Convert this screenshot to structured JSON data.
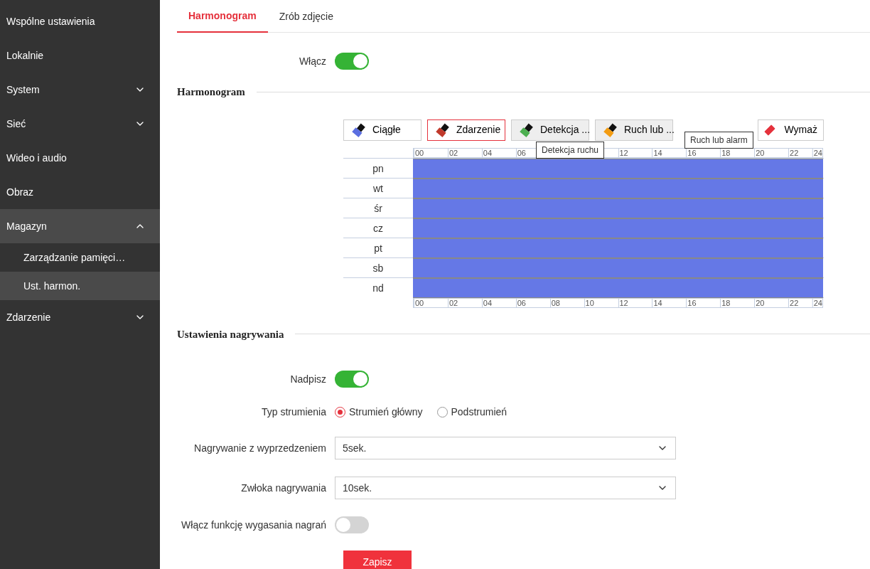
{
  "sidebar": {
    "items": [
      {
        "label": "Wspólne ustawienia"
      },
      {
        "label": "Lokalnie"
      },
      {
        "label": "System",
        "expanded": false
      },
      {
        "label": "Sieć",
        "expanded": false
      },
      {
        "label": "Wideo i audio"
      },
      {
        "label": "Obraz"
      },
      {
        "label": "Magazyn",
        "expanded": true,
        "children": [
          {
            "label": "Zarządzanie pamięci…",
            "selected": false
          },
          {
            "label": "Ust. harmon.",
            "selected": true
          }
        ]
      },
      {
        "label": "Zdarzenie",
        "expanded": false
      }
    ]
  },
  "tabs": [
    {
      "label": "Harmonogram",
      "selected": true
    },
    {
      "label": "Zrób zdjęcie",
      "selected": false
    }
  ],
  "enable": {
    "label": "Włącz",
    "on": true
  },
  "schedule": {
    "title": "Harmonogram",
    "tools": [
      {
        "label": "Ciągłe",
        "color": "#5b6ee0",
        "selected": false,
        "hovered": false
      },
      {
        "label": "Zdarzenie",
        "color": "#c0392b",
        "selected": true,
        "hovered": false
      },
      {
        "label": "Detekcja ...",
        "color": "#4caf50",
        "selected": false,
        "hovered": true,
        "tooltip": {
          "text": "Detekcja ruchu",
          "kind": "below"
        }
      },
      {
        "label": "Ruch lub ...",
        "color": "#f39c12",
        "selected": false,
        "hovered": true,
        "tooltip": {
          "text": "Ruch lub alarm",
          "kind": "beside"
        }
      }
    ],
    "erase": {
      "label": "Wymaż"
    },
    "hours_top": [
      {
        "label": "00",
        "covered": false
      },
      {
        "label": "02",
        "covered": false
      },
      {
        "label": "04",
        "covered": false
      },
      {
        "label": "06",
        "covered": false
      },
      {
        "covered": true
      },
      {
        "covered": true
      },
      {
        "label": "12",
        "covered": false
      },
      {
        "label": "14",
        "covered": false
      },
      {
        "label": "16",
        "covered": false
      },
      {
        "label": "18",
        "covered": false
      },
      {
        "label": "20",
        "covered": false
      },
      {
        "label": "22",
        "covered": false
      },
      {
        "label": "24",
        "covered": false
      }
    ],
    "hours_bottom": [
      {
        "label": "00",
        "covered": false
      },
      {
        "label": "02",
        "covered": false
      },
      {
        "label": "04",
        "covered": false
      },
      {
        "label": "06",
        "covered": false
      },
      {
        "label": "08",
        "covered": false
      },
      {
        "label": "10",
        "covered": false
      },
      {
        "label": "12",
        "covered": false
      },
      {
        "label": "14",
        "covered": false
      },
      {
        "label": "16",
        "covered": false
      },
      {
        "label": "18",
        "covered": false
      },
      {
        "label": "20",
        "covered": false
      },
      {
        "label": "22",
        "covered": false
      },
      {
        "label": "24",
        "covered": false
      }
    ],
    "days": [
      {
        "label": "pn",
        "level": 1
      },
      {
        "label": "wt",
        "level": 1
      },
      {
        "label": "śr",
        "level": 1
      },
      {
        "label": "cz",
        "level": 1
      },
      {
        "label": "pt",
        "level": 1
      },
      {
        "label": "sb",
        "level": 1
      },
      {
        "label": "nd",
        "level": 1
      }
    ]
  },
  "recording": {
    "title": "Ustawienia nagrywania",
    "overwrite": {
      "label": "Nadpisz",
      "on": true
    },
    "stream": {
      "label": "Typ strumienia",
      "options": [
        {
          "label": "Strumień główny",
          "selected": true
        },
        {
          "label": "Podstrumień",
          "selected": false
        }
      ]
    },
    "prerecord": {
      "label": "Nagrywanie z wyprzedzeniem",
      "value": "5sek."
    },
    "delay": {
      "label": "Zwłoka nagrywania",
      "value": "10sek."
    },
    "expiry": {
      "label": "Włącz funkcję wygasania nagrań",
      "on": false
    },
    "save": "Zapisz"
  }
}
